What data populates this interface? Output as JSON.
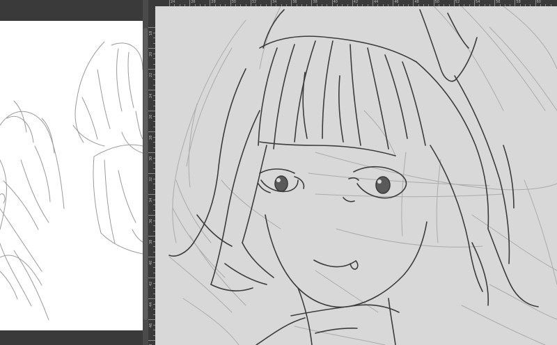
{
  "app": {
    "window": "drawing-app",
    "view": "split-canvas"
  },
  "colors": {
    "ui_dark": "#2b2b2b",
    "panel": "#3a3a3a",
    "canvas_left": "#ffffff",
    "canvas_right": "#d8d8d8",
    "sketch_line": "#3a3a3a",
    "guide_line": "#a8a8a8"
  },
  "rulers": {
    "top_labels": [
      "24",
      "26",
      "28",
      "30",
      "32",
      "34",
      "36",
      "38",
      "40",
      "42",
      "44",
      "46",
      "48",
      "50",
      "52",
      "54",
      "56",
      "58",
      "60"
    ],
    "left_labels": [
      "18",
      "20",
      "22",
      "24",
      "26",
      "28",
      "30",
      "32",
      "34",
      "36",
      "38",
      "40",
      "42",
      "44",
      "46",
      "48"
    ]
  },
  "icons": {
    "scroll_thumb": "scrollbar-thumb"
  }
}
